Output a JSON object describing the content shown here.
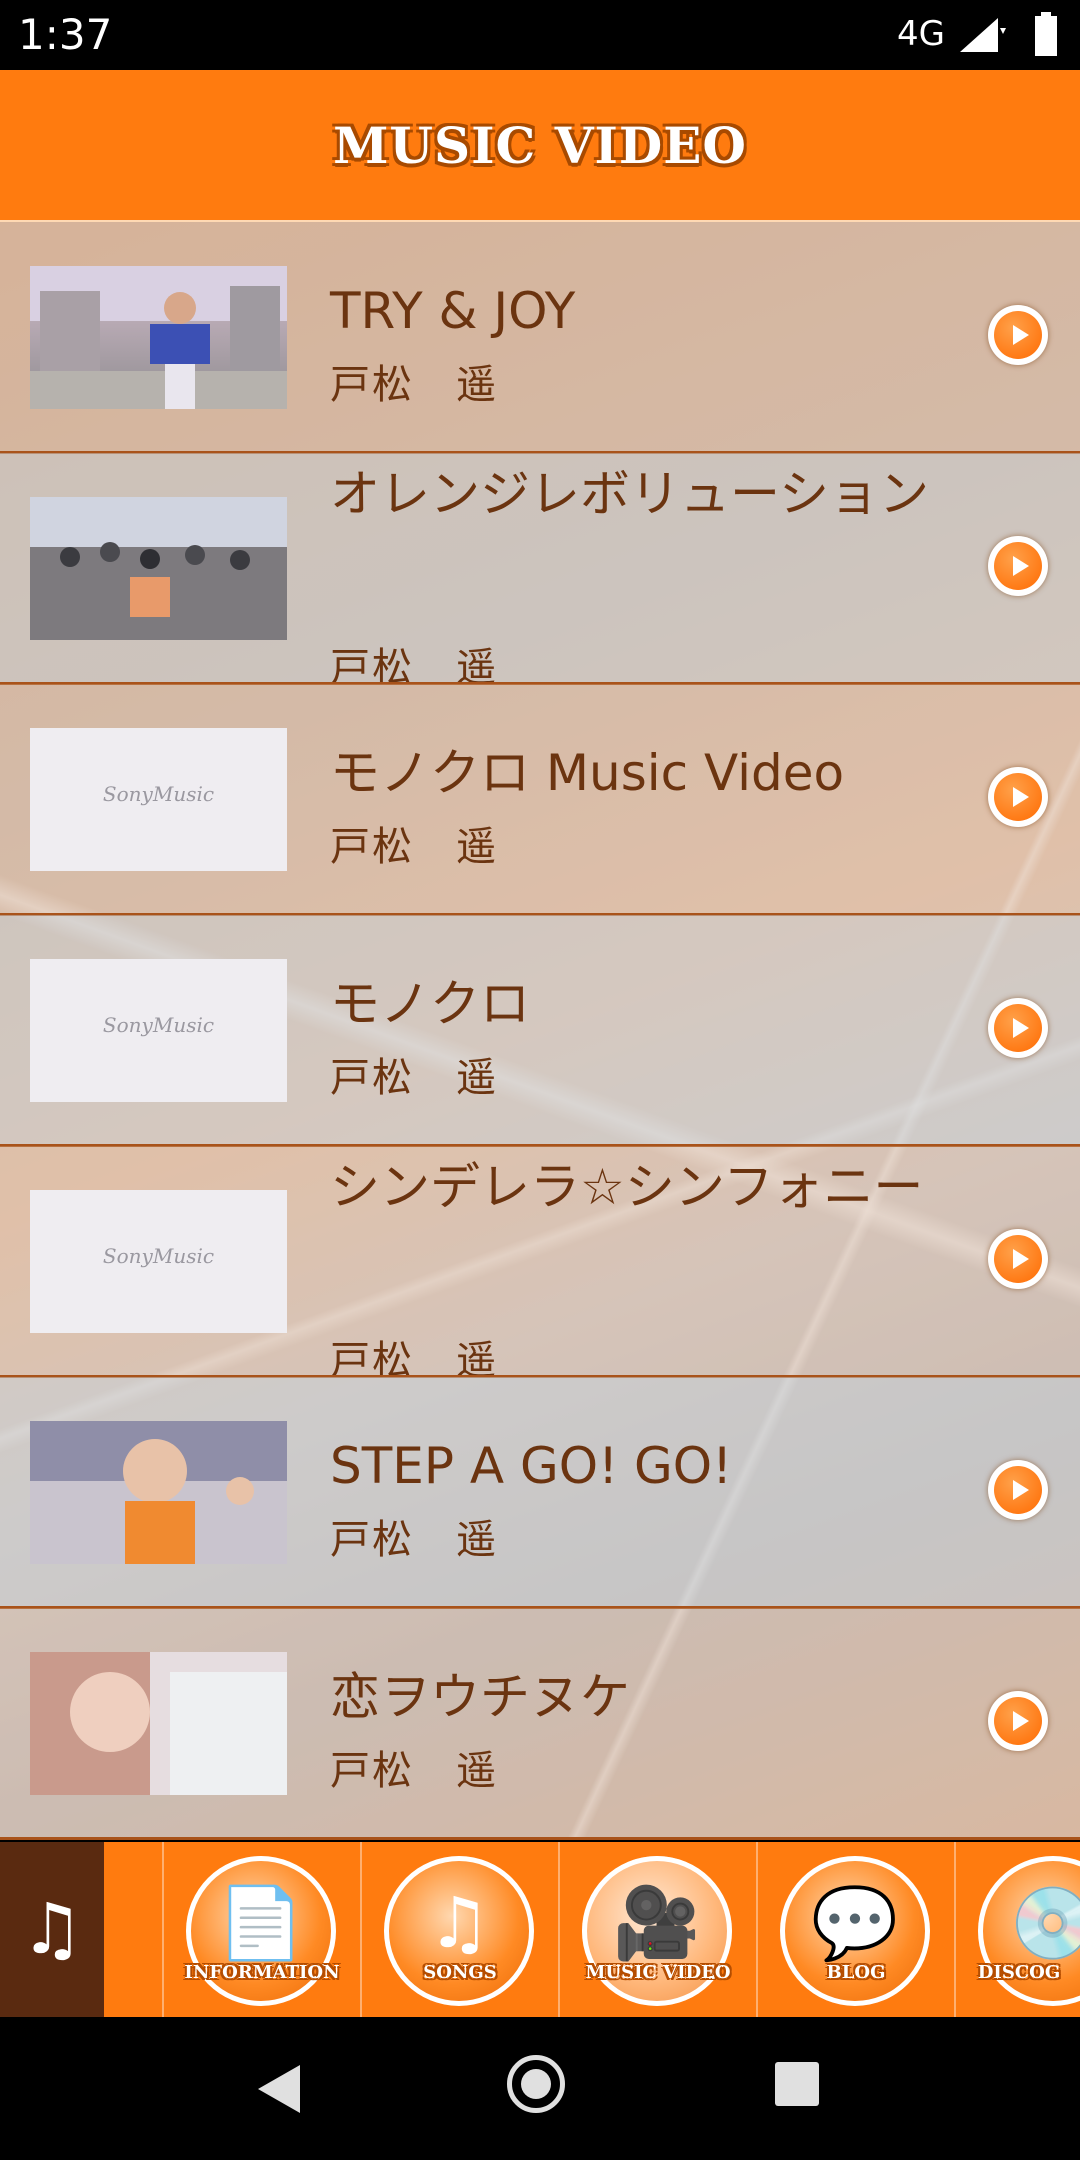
{
  "status_bar": {
    "time": "1:37",
    "network": "4G"
  },
  "header": {
    "title": "MUSIC VIDEO"
  },
  "videos": [
    {
      "title": "TRY & JOY",
      "artist": "戸松　遥",
      "thumb": "photo"
    },
    {
      "title": "オレンジレボリューション",
      "artist": "戸松　遥",
      "thumb": "photo"
    },
    {
      "title": "モノクロ Music Video",
      "artist": "戸松　遥",
      "thumb": "SonyMusic"
    },
    {
      "title": "モノクロ",
      "artist": "戸松　遥",
      "thumb": "SonyMusic"
    },
    {
      "title": "シンデレラ☆シンフォニー",
      "artist": "戸松　遥",
      "thumb": "SonyMusic"
    },
    {
      "title": "STEP A GO! GO!",
      "artist": "戸松　遥",
      "thumb": "photo"
    },
    {
      "title": "恋ヲウチヌケ",
      "artist": "戸松　遥",
      "thumb": "photo"
    }
  ],
  "tabs": [
    {
      "label": "INFORMATION",
      "glyph": "📄"
    },
    {
      "label": "SONGS",
      "glyph": "♫"
    },
    {
      "label": "MUSIC VIDEO",
      "glyph": "🎥"
    },
    {
      "label": "BLOG",
      "glyph": "💬"
    },
    {
      "label": "DISCOG",
      "glyph": "💿"
    }
  ],
  "music_toggle": {
    "glyph": "♫"
  },
  "colors": {
    "accent": "#ff7b0f",
    "text": "#6b3410",
    "divider": "#a9531a"
  }
}
